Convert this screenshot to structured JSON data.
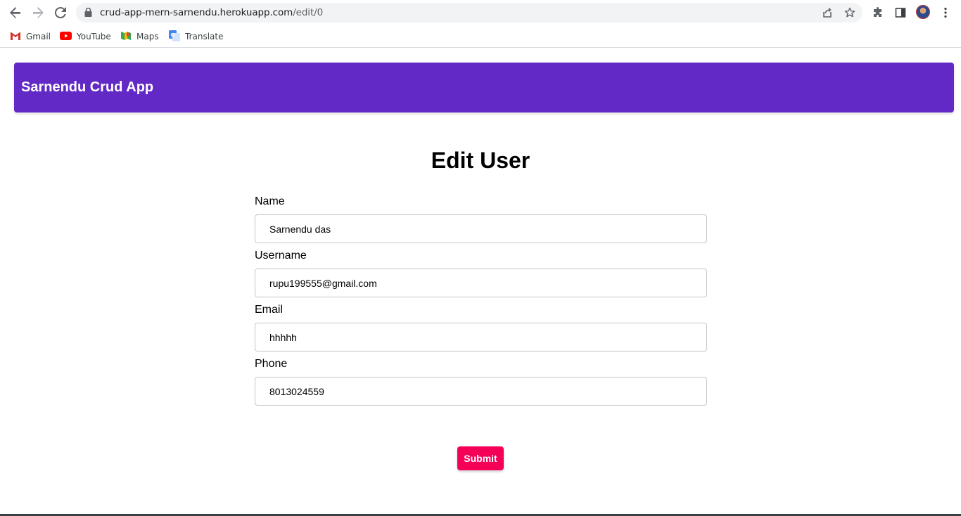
{
  "browser": {
    "url_host": "crud-app-mern-sarnendu.herokuapp.com",
    "url_path": "/edit/0",
    "bookmarks": [
      {
        "label": "Gmail",
        "icon": "gmail-icon"
      },
      {
        "label": "YouTube",
        "icon": "youtube-icon"
      },
      {
        "label": "Maps",
        "icon": "maps-icon"
      },
      {
        "label": "Translate",
        "icon": "translate-icon"
      }
    ]
  },
  "app": {
    "title": "Sarnendu Crud App",
    "accent": "#6229c6",
    "submit_color": "#f50057"
  },
  "form": {
    "heading": "Edit User",
    "fields": [
      {
        "label": "Name",
        "value": "Sarnendu das"
      },
      {
        "label": "Username",
        "value": "rupu199555@gmail.com"
      },
      {
        "label": "Email",
        "value": "hhhhh"
      },
      {
        "label": "Phone",
        "value": "8013024559"
      }
    ],
    "submit_label": "Submit"
  }
}
